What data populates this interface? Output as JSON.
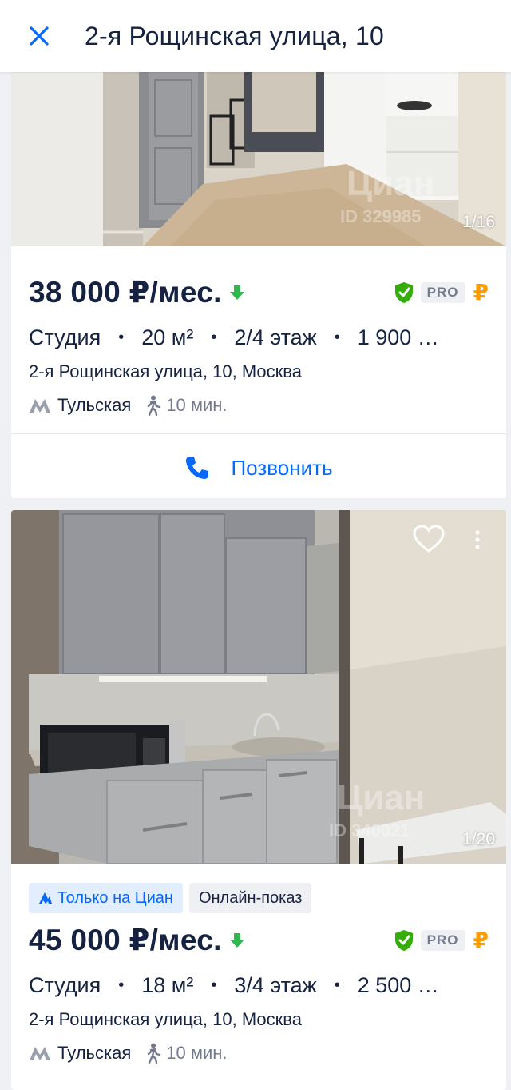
{
  "header": {
    "title": "2-я Рощинская улица, 10"
  },
  "listings": [
    {
      "photo_counter": "1/16",
      "watermark": "Циан",
      "watermark_id": "ID 329985",
      "price": "38 000 ₽/мес.",
      "pro_label": "PRO",
      "rub_icon": "₽",
      "params": [
        "Студия",
        "20 м²",
        "2/4 этаж",
        "1 900 …"
      ],
      "address": "2-я Рощинская улица, 10, Москва",
      "metro": "Тульская",
      "walk_time": "10 мин.",
      "call_label": "Позвонить"
    },
    {
      "photo_counter": "1/20",
      "watermark": "Циан",
      "watermark_id": "ID 340021",
      "tags": [
        "Только на Циан",
        "Онлайн-показ"
      ],
      "price": "45 000 ₽/мес.",
      "pro_label": "PRO",
      "rub_icon": "₽",
      "params": [
        "Студия",
        "18 м²",
        "3/4 этаж",
        "2 500 …"
      ],
      "address": "2-я Рощинская улица, 10, Москва",
      "metro": "Тульская",
      "walk_time": "10 мин."
    }
  ],
  "colors": {
    "accent": "#0468ff",
    "price_down": "#2fb84e",
    "verified": "#34ac0a",
    "rub": "#ff9d00",
    "text": "#152242",
    "muted": "#737a8e"
  }
}
